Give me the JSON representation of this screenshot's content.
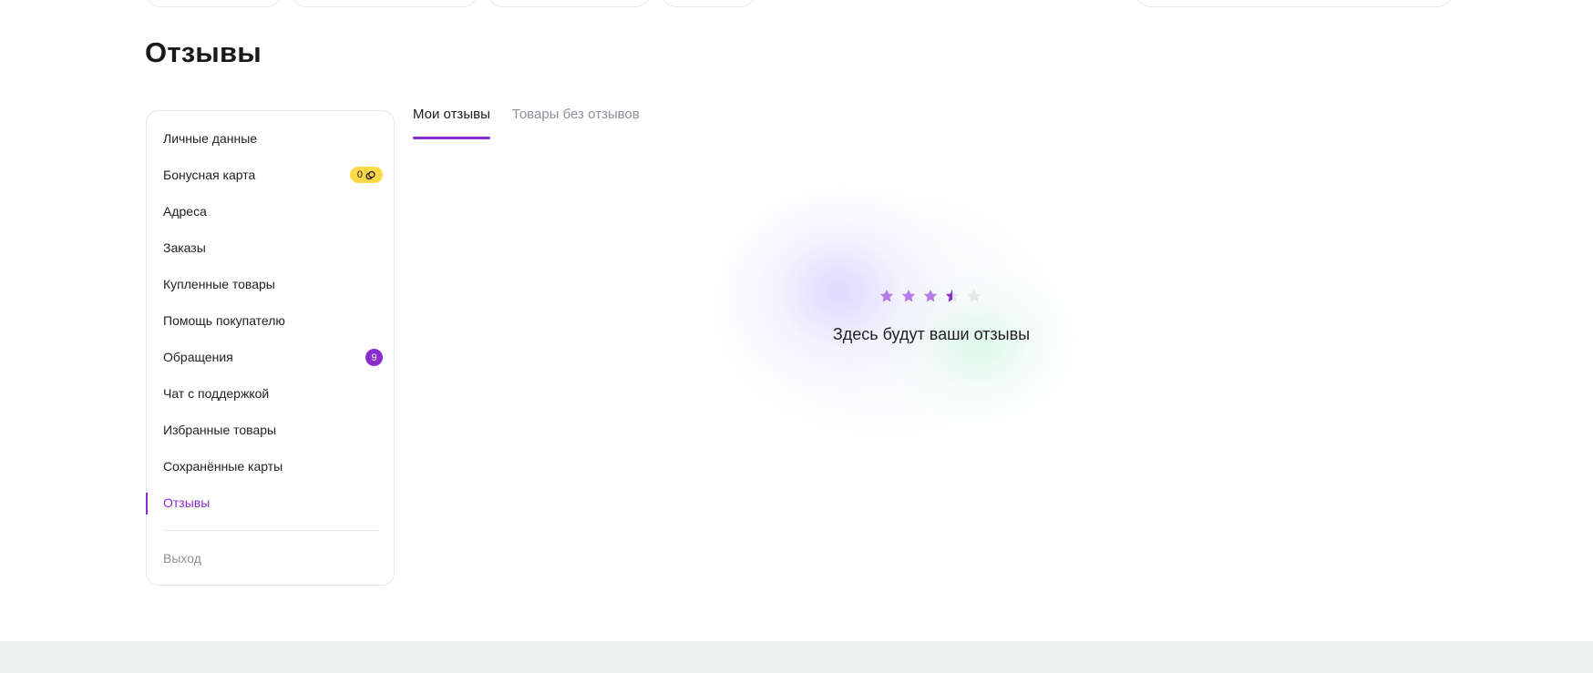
{
  "page": {
    "title": "Отзывы"
  },
  "sidebar": {
    "items": [
      {
        "label": "Личные данные"
      },
      {
        "label": "Бонусная карта",
        "badge": "0"
      },
      {
        "label": "Адреса"
      },
      {
        "label": "Заказы"
      },
      {
        "label": "Купленные товары"
      },
      {
        "label": "Помощь покупателю"
      },
      {
        "label": "Обращения",
        "badge": "9"
      },
      {
        "label": "Чат с поддержкой"
      },
      {
        "label": "Избранные товары"
      },
      {
        "label": "Сохранённые карты"
      },
      {
        "label": "Отзывы",
        "active": true
      }
    ],
    "exit_label": "Выход"
  },
  "tabs": [
    {
      "label": "Мои отзывы",
      "active": true
    },
    {
      "label": "Товары без отзывов"
    }
  ],
  "empty_state": {
    "message": "Здесь будут ваши отзывы",
    "rating_filled": 3.5,
    "rating_max": 5
  },
  "colors": {
    "accent": "#8a2ccf",
    "badge_yellow": "#ffd84a",
    "star_filled": "#b57be6",
    "star_empty": "#e3e5ea",
    "muted_text": "#8b9096",
    "footer": "#edf0ef"
  },
  "icons": {
    "bonus_badge_icon": "coin-icon",
    "star_icon": "star-icon"
  }
}
